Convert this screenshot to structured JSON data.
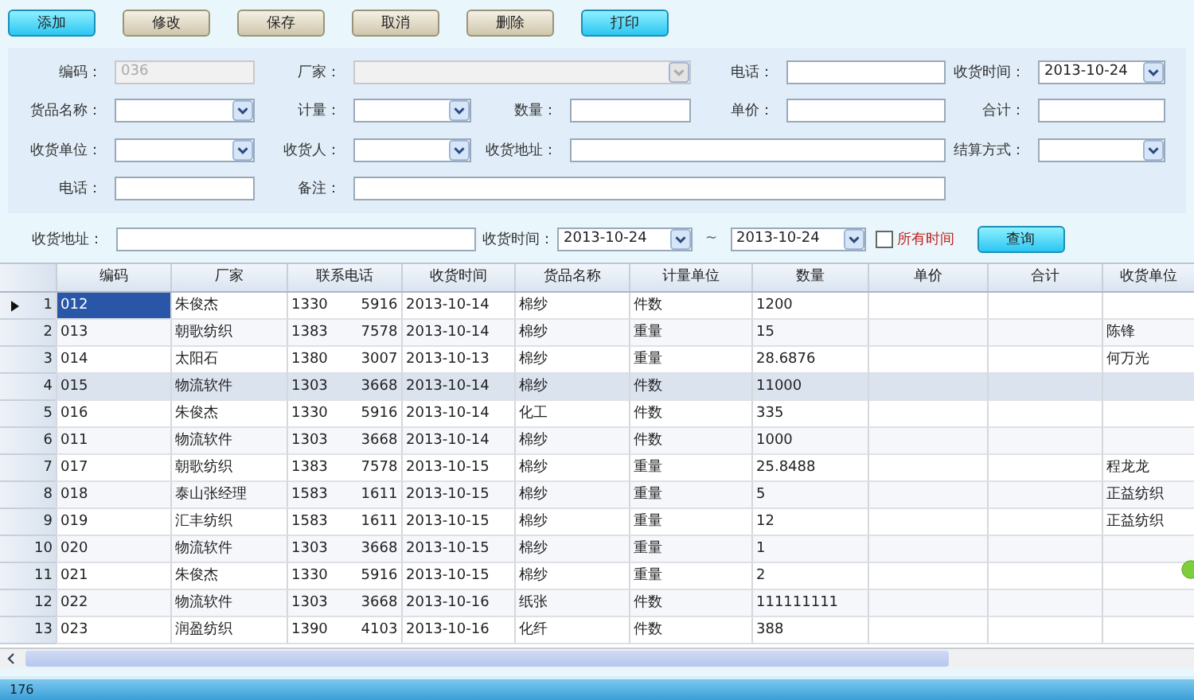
{
  "toolbar": [
    {
      "label": "添加",
      "kind": "primary"
    },
    {
      "label": "修改",
      "kind": "normal"
    },
    {
      "label": "保存",
      "kind": "normal"
    },
    {
      "label": "取消",
      "kind": "normal"
    },
    {
      "label": "删除",
      "kind": "normal"
    },
    {
      "label": "打印",
      "kind": "primary"
    }
  ],
  "form": {
    "rows": [
      [
        {
          "label": "编码：",
          "kind": "text",
          "value": "036",
          "disabled": true
        },
        {
          "label": "厂家：",
          "kind": "dropdown",
          "disabled": true
        },
        {
          "label": "电话：",
          "kind": "text",
          "disabled": false
        },
        {
          "label": "收货时间：",
          "kind": "dropdown",
          "value": "2013-10-24",
          "disabled": false
        }
      ],
      [
        {
          "label": "货品名称：",
          "kind": "dropdown",
          "disabled": false
        },
        {
          "label": "计量：",
          "kind": "dropdown",
          "disabled": false
        },
        {
          "label": "数量：",
          "kind": "text",
          "disabled": false
        },
        {
          "label": "单价：",
          "kind": "text",
          "disabled": false
        },
        {
          "label": "合计：",
          "kind": "text",
          "disabled": false
        }
      ],
      [
        {
          "label": "收货单位：",
          "kind": "dropdown",
          "disabled": false
        },
        {
          "label": "收货人：",
          "kind": "dropdown",
          "disabled": false
        },
        {
          "label": "收货地址：",
          "kind": "text",
          "disabled": false
        },
        {
          "label": "结算方式：",
          "kind": "dropdown",
          "disabled": false
        }
      ],
      [
        {
          "label": "电话：",
          "kind": "text",
          "disabled": false
        },
        {
          "label": "备注：",
          "kind": "text",
          "disabled": false
        }
      ]
    ]
  },
  "search": {
    "address_label": "收货地址：",
    "time_label": "收货时间：",
    "from": "2013-10-24",
    "separator": "~",
    "to": "2013-10-24",
    "all_time": {
      "label": "所有时间",
      "checked": false
    },
    "button": "查询"
  },
  "table": {
    "columns": [
      "编码",
      "厂家",
      "联系电话",
      "收货时间",
      "货品名称",
      "计量单位",
      "数量",
      "单价",
      "合计",
      "收货单位"
    ],
    "rows": [
      {
        "number": "1",
        "current": true,
        "selected": false,
        "cells": [
          "012",
          "朱俊杰",
          "1330 5916",
          "2013-10-14",
          "棉纱",
          "件数",
          "1200",
          "",
          "",
          ""
        ]
      },
      {
        "number": "2",
        "current": false,
        "selected": false,
        "cells": [
          "013",
          "朝歌纺织",
          "1383 7578",
          "2013-10-14",
          "棉纱",
          "重量",
          "15",
          "",
          "",
          "陈锋"
        ]
      },
      {
        "number": "3",
        "current": false,
        "selected": false,
        "cells": [
          "014",
          "太阳石",
          "1380 3007",
          "2013-10-13",
          "棉纱",
          "重量",
          "28.6876",
          "",
          "",
          "何万光"
        ]
      },
      {
        "number": "4",
        "current": false,
        "selected": true,
        "cells": [
          "015",
          "物流软件",
          "1303 3668",
          "2013-10-14",
          "棉纱",
          "件数",
          "11000",
          "",
          "",
          ""
        ]
      },
      {
        "number": "5",
        "current": false,
        "selected": false,
        "cells": [
          "016",
          "朱俊杰",
          "1330 5916",
          "2013-10-14",
          "化工",
          "件数",
          "335",
          "",
          "",
          ""
        ]
      },
      {
        "number": "6",
        "current": false,
        "selected": false,
        "cells": [
          "011",
          "物流软件",
          "1303 3668",
          "2013-10-14",
          "棉纱",
          "件数",
          "1000",
          "",
          "",
          ""
        ]
      },
      {
        "number": "7",
        "current": false,
        "selected": false,
        "cells": [
          "017",
          "朝歌纺织",
          "1383 7578",
          "2013-10-15",
          "棉纱",
          "重量",
          "25.8488",
          "",
          "",
          "程龙龙"
        ]
      },
      {
        "number": "8",
        "current": false,
        "selected": false,
        "cells": [
          "018",
          "泰山张经理",
          "1583 1611",
          "2013-10-15",
          "棉纱",
          "重量",
          "5",
          "",
          "",
          "正益纺织"
        ]
      },
      {
        "number": "9",
        "current": false,
        "selected": false,
        "cells": [
          "019",
          "汇丰纺织",
          "1583 1611",
          "2013-10-15",
          "棉纱",
          "重量",
          "12",
          "",
          "",
          "正益纺织"
        ]
      },
      {
        "number": "10",
        "current": false,
        "selected": false,
        "cells": [
          "020",
          "物流软件",
          "1303 3668",
          "2013-10-15",
          "棉纱",
          "重量",
          "1",
          "",
          "",
          ""
        ]
      },
      {
        "number": "11",
        "current": false,
        "selected": false,
        "cells": [
          "021",
          "朱俊杰",
          "1330 5916",
          "2013-10-15",
          "棉纱",
          "重量",
          "2",
          "",
          "",
          ""
        ]
      },
      {
        "number": "12",
        "current": false,
        "selected": false,
        "cells": [
          "022",
          "物流软件",
          "1303 3668",
          "2013-10-16",
          "纸张",
          "件数",
          "111111111",
          "",
          "",
          ""
        ]
      },
      {
        "number": "13",
        "current": false,
        "selected": false,
        "cells": [
          "023",
          "润盈纺织",
          "1390 4103",
          "2013-10-16",
          "化纤",
          "件数",
          "388",
          "",
          "",
          ""
        ]
      }
    ]
  },
  "status_bar": {
    "text": "176"
  }
}
